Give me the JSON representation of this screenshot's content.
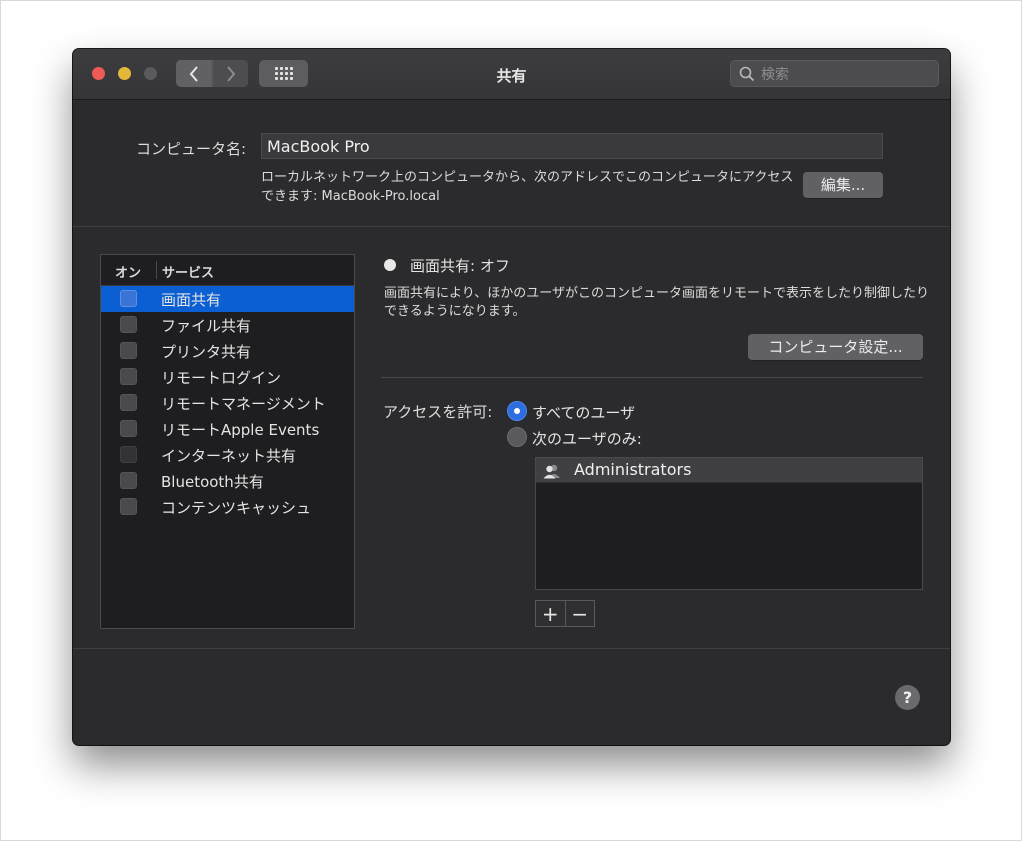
{
  "window": {
    "title": "共有",
    "search_placeholder": "検索"
  },
  "computer": {
    "name_label": "コンピュータ名:",
    "name_value": "MacBook Pro",
    "address_text": "ローカルネットワーク上のコンピュータから、次のアドレスでこのコンピュータにアクセスできます: MacBook-Pro.local",
    "edit_button": "編集..."
  },
  "services": {
    "col_on": "オン",
    "col_service": "サービス",
    "items": [
      {
        "label": "画面共有",
        "checked": false,
        "selected": true
      },
      {
        "label": "ファイル共有",
        "checked": false
      },
      {
        "label": "プリンタ共有",
        "checked": false
      },
      {
        "label": "リモートログイン",
        "checked": false
      },
      {
        "label": "リモートマネージメント",
        "checked": false
      },
      {
        "label": "リモートApple Events",
        "checked": false
      },
      {
        "label": "インターネット共有",
        "checked": false,
        "disabled": true
      },
      {
        "label": "Bluetooth共有",
        "checked": false
      },
      {
        "label": "コンテンツキャッシュ",
        "checked": false
      }
    ]
  },
  "detail": {
    "status": "画面共有: オフ",
    "description": "画面共有により、ほかのユーザがこのコンピュータ画面をリモートで表示をしたり制御したりできるようになります。",
    "computer_settings_button": "コンピュータ設定...",
    "access_label": "アクセスを許可:",
    "radio_all": "すべてのユーザ",
    "radio_only": "次のユーザのみ:",
    "selected_option": "すべてのユーザ",
    "users": [
      "Administrators"
    ],
    "plus": "+",
    "minus": "−"
  },
  "help": "?",
  "colors": {
    "accent": "#0b5fd3",
    "window_bg": "#2b2b2d",
    "close": "#ee5b55",
    "minimize": "#e3b83a"
  }
}
